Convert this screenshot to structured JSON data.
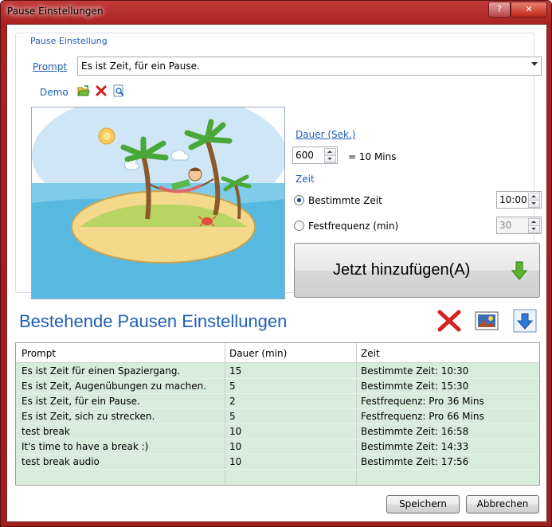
{
  "window": {
    "title": "Pause Einstellungen",
    "help": "?",
    "close": "✕"
  },
  "group": {
    "legend": "Pause Einstellung"
  },
  "prompt": {
    "label": "Prompt",
    "value": "Es ist Zeit, für ein Pause."
  },
  "demo": {
    "label": "Demo"
  },
  "dauer": {
    "label": "Dauer (Sek.)",
    "value": "600",
    "mins": "= 10 Mins"
  },
  "zeit": {
    "label": "Zeit",
    "options": [
      {
        "label": "Bestimmte Zeit",
        "value": "10:00",
        "selected": true
      },
      {
        "label": "Festfrequenz (min)",
        "value": "30",
        "selected": false
      }
    ]
  },
  "add_button": {
    "label": "Jetzt hinzufügen(A)"
  },
  "section": {
    "title": "Bestehende Pausen Einstellungen"
  },
  "table": {
    "columns": [
      "Prompt",
      "Dauer (min)",
      "Zeit"
    ],
    "rows": [
      [
        "Es ist Zeit für einen Spaziergang.",
        "15",
        "Bestimmte Zeit: 10:30"
      ],
      [
        "Es ist Zeit, Augenübungen zu machen.",
        "5",
        "Bestimmte Zeit: 15:30"
      ],
      [
        "Es ist Zeit, für ein Pause.",
        "2",
        "Festfrequenz: Pro 36 Mins"
      ],
      [
        "Es ist Zeit, sich zu strecken.",
        "5",
        "Festfrequenz: Pro 66 Mins"
      ],
      [
        "test break",
        "10",
        "Bestimmte Zeit: 16:58"
      ],
      [
        "It's time to have a break :)",
        "10",
        "Bestimmte Zeit: 14:33"
      ],
      [
        "test break audio",
        "10",
        "Bestimmte Zeit: 17:56"
      ]
    ]
  },
  "footer": {
    "save": "Speichern",
    "cancel": "Abbrechen"
  },
  "colors": {
    "accent": "#1e5fb4",
    "titlebar": "#a82222",
    "table_bg": "#d8ecdc"
  }
}
